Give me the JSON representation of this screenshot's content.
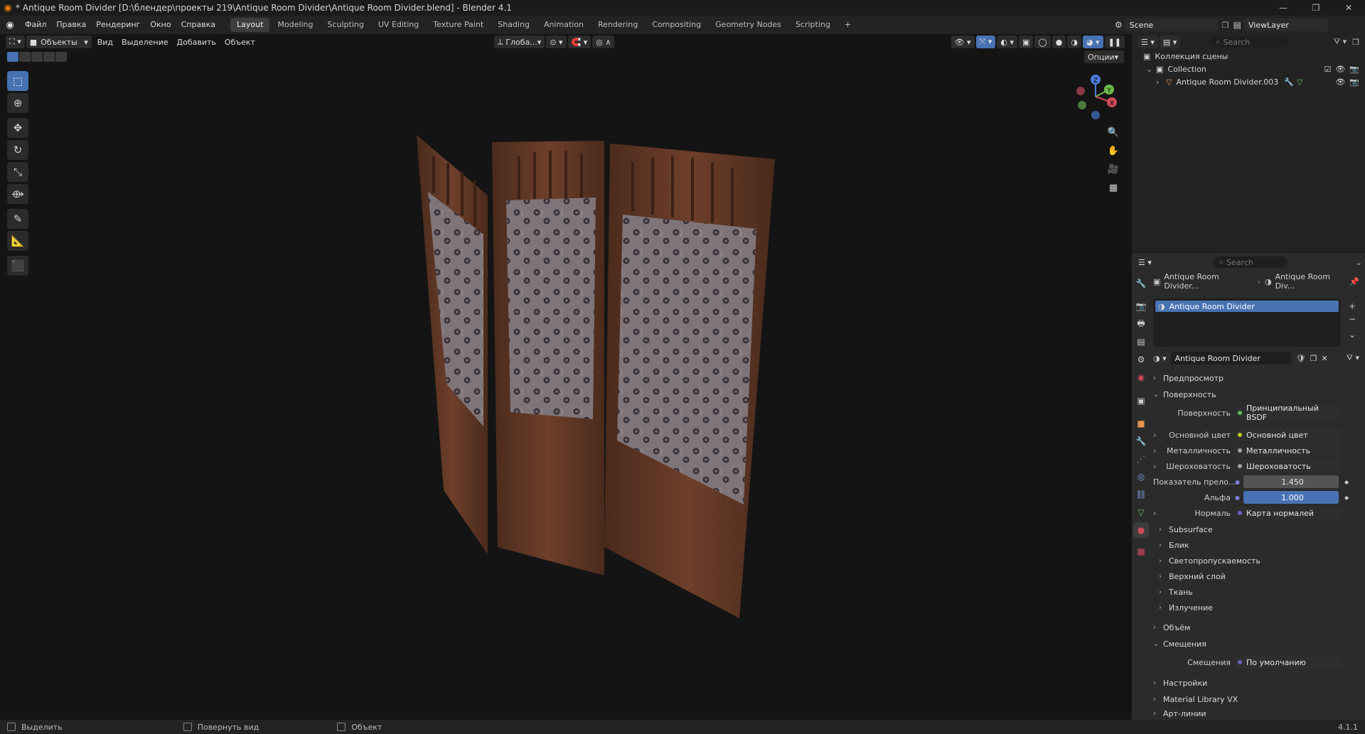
{
  "titlebar": {
    "title": "* Antique Room Divider [D:\\блендер\\проекты 219\\Antique Room Divider\\Antique Room Divider.blend] - Blender 4.1"
  },
  "menu": {
    "items": [
      "Файл",
      "Правка",
      "Рендеринг",
      "Окно",
      "Справка"
    ]
  },
  "workspaces": {
    "tabs": [
      "Layout",
      "Modeling",
      "Sculpting",
      "UV Editing",
      "Texture Paint",
      "Shading",
      "Animation",
      "Rendering",
      "Compositing",
      "Geometry Nodes",
      "Scripting"
    ],
    "add": "+"
  },
  "scene": {
    "name": "Scene",
    "view_layer": "ViewLayer"
  },
  "viewport_header": {
    "mode": "Объекты",
    "menus": [
      "Вид",
      "Выделение",
      "Добавить",
      "Объект"
    ],
    "orientation": "Глоба...",
    "options": "Опции"
  },
  "gizmo": {
    "x": "X",
    "y": "Y",
    "z": "Z"
  },
  "outliner": {
    "search_placeholder": "Search",
    "scene_collection": "Коллекция сцены",
    "collection": "Collection",
    "object": "Antique Room Divider.003"
  },
  "properties": {
    "search_placeholder": "Search",
    "breadcrumb": [
      "Antique Room Divider...",
      "Antique Room Div..."
    ],
    "slot": "Antique Room Divider",
    "material_name": "Antique Room Divider",
    "sections": {
      "preview": "Предпросмотр",
      "surface": "Поверхность",
      "volume": "Объём",
      "displacement": "Смещения",
      "settings": "Настройки",
      "matlib": "Material Library VX",
      "lineart": "Арт-линии"
    },
    "surface_label": "Поверхность",
    "surface_value": "Принципиальный BSDF",
    "rows": [
      {
        "label": "Основной цвет",
        "value": "Основной цвет"
      },
      {
        "label": "Металличность",
        "value": "Металличность"
      },
      {
        "label": "Шероховатость",
        "value": "Шероховатость"
      }
    ],
    "ior": {
      "label": "Показатель прело...",
      "value": "1.450"
    },
    "alpha": {
      "label": "Альфа",
      "value": "1.000"
    },
    "normal": {
      "label": "Нормаль",
      "value": "Карта нормалей"
    },
    "subsections": [
      "Subsurface",
      "Блик",
      "Светопропускаемость",
      "Верхний слой",
      "Ткань",
      "Излучение"
    ],
    "displacement_label": "Смещения",
    "displacement_value": "По умолчанию"
  },
  "statusbar": {
    "select": "Выделить",
    "rotate": "Повернуть вид",
    "object": "Объект",
    "version": "4.1.1"
  }
}
